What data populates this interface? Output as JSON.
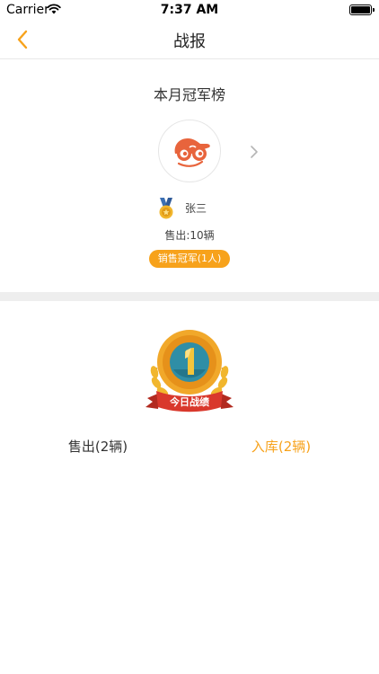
{
  "status_bar": {
    "carrier": "Carrier",
    "time": "7:37 AM"
  },
  "nav": {
    "title": "战报",
    "back_icon": "chevron-left-icon",
    "accent": "#f7a21b"
  },
  "champion": {
    "heading": "本月冠军榜",
    "name": "张三",
    "sold": "售出:10辆",
    "badge": "销售冠军(1人)"
  },
  "today": {
    "emblem_text": "今日战绩",
    "sold_tab": "售出(2辆)",
    "stock_tab": "入库(2辆)"
  },
  "colors": {
    "accent": "#f7a21b",
    "avatar_red": "#e8643c",
    "ribbon_red": "#d9382c",
    "divider": "#eeeeee"
  }
}
